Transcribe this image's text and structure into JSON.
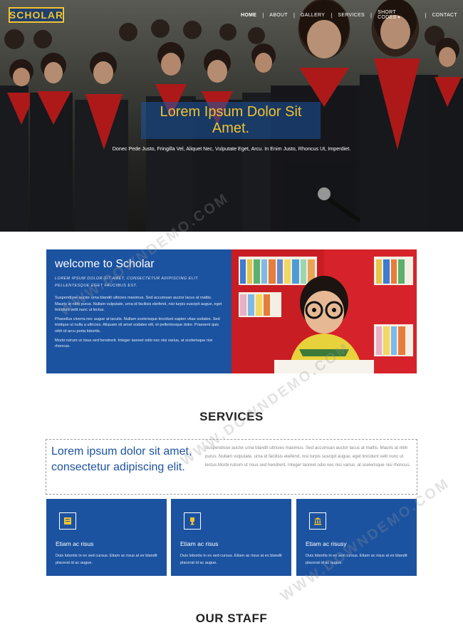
{
  "header": {
    "logo": "SCHOLAR",
    "nav": [
      {
        "label": "HOME",
        "active": true
      },
      {
        "label": "ABOUT"
      },
      {
        "label": "GALLERY"
      },
      {
        "label": "SERVICES"
      },
      {
        "label": "SHORT CODES",
        "has_caret": true
      },
      {
        "label": "CONTACT"
      }
    ]
  },
  "hero": {
    "title": "Lorem Ipsum Dolor Sit Amet.",
    "subtitle": "Donec Pede Justo, Fringilla Vel, Aliquet Nec, Vulputate Eget, Arcu. In Enim Justo, Rhoncus Ut, Imperdiet."
  },
  "welcome": {
    "title": "welcome to Scholar",
    "tagline": "Lorem ipsum dolor sit amet, consectetur adipiscing elit. Pellentesque eget faucibus est.",
    "paragraphs": [
      "Suspendisse auctor urna blandit ultricies maximus. Sed accumsan auctor lacus at mattis. Mauris at nibh purus. Nullam vulputate, urna id facilisis eleifend, nisi turpis suscipit augue, eget tincidunt velit nunc ut lectus.",
      "Phasellus viverra nec augue at iaculis. Nullam scelerisque tincidunt sapien vitae sodales. Sed tristique ut nulla a ultricies. Aliquam sit amet sodales elit, et pellentesque dolor. Praesent quis nibh id arcu porta lobortis.",
      "Morbi rutrum ut risus sed hendrerit. Integer laoreet odio nec nisi varius, at scelerisque nisi rhoncus."
    ]
  },
  "services": {
    "title": "SERVICES",
    "lead": "Lorem ipsum dolor sit amet, consectetur adipiscing elit.",
    "text": "Suspendisse auctor urna blandit ultricies maximus. Sed accumsan auctor lacus at mattis. Mauris at nibh purus. Nullam vulputate, urna id facilisis eleifend, nisi turpis suscipit augue, eget tincidunt velit nunc ut lectus.Morbi rutrum ut risus sed hendrerit. Integer laoreet odio nec nisi varius, at scelerisque nisi rhoncus.",
    "cards": [
      {
        "icon": "book-icon",
        "title": "Etiam ac risus",
        "desc": "Duis lobortis in ex sed cursus. Etiam ac risus at ex blandit placerat id ac augue."
      },
      {
        "icon": "trophy-icon",
        "title": "Etiam ac risus",
        "desc": "Duis lobortis in ex sed cursus. Etiam ac risus at ex blandit placerat id ac augue."
      },
      {
        "icon": "bank-icon",
        "title": "Etiam ac risusy",
        "desc": "Duis lobortis in ex sed cursus. Etiam ac risus at ex blandit placerat id ac augue."
      }
    ]
  },
  "staff": {
    "title": "OUR STAFF"
  },
  "watermark": "WWW.DOWNDEMO.COM",
  "colors": {
    "brand_blue": "#1c53a0",
    "accent_yellow": "#f2c230",
    "logo_bg": "#1f3f6c"
  }
}
